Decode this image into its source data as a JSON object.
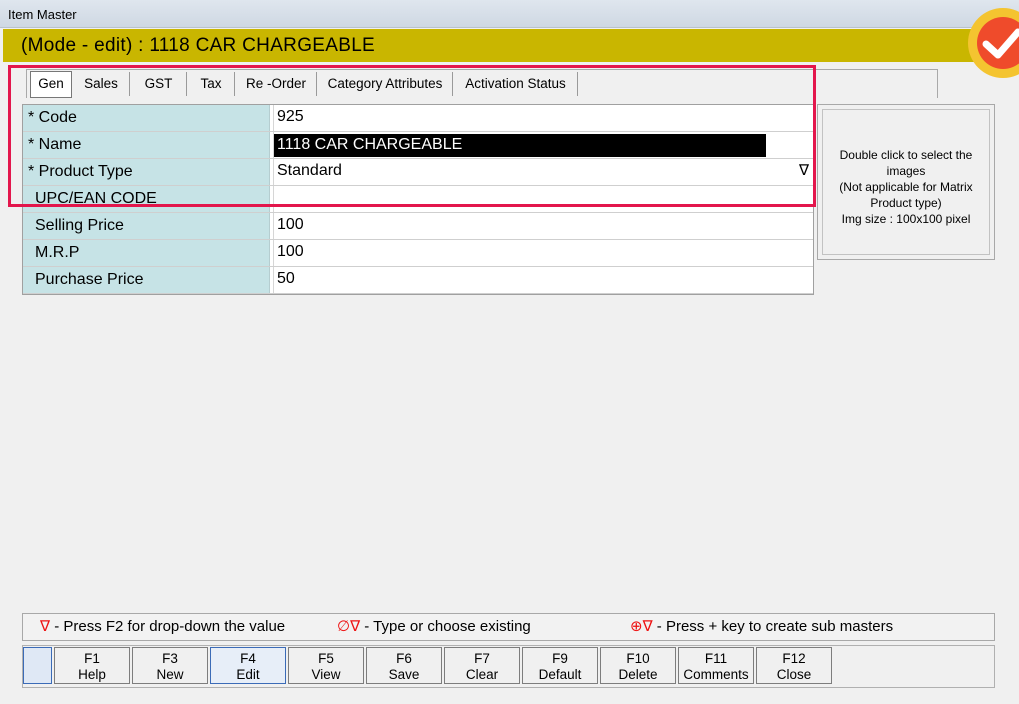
{
  "window": {
    "title": "Item Master"
  },
  "mode_bar": {
    "text": "(Mode - edit)  :  1118 CAR CHARGEABLE"
  },
  "tabs": [
    {
      "label": "Gen"
    },
    {
      "label": "Sales"
    },
    {
      "label": "GST"
    },
    {
      "label": "Tax"
    },
    {
      "label": "Re -Order"
    },
    {
      "label": "Category Attributes"
    },
    {
      "label": "Activation Status"
    }
  ],
  "fields": [
    {
      "label": "* Code",
      "value": "925"
    },
    {
      "label": "* Name",
      "value": "1118 CAR CHARGEABLE"
    },
    {
      "label": "* Product Type",
      "value": "Standard"
    },
    {
      "label": "UPC/EAN CODE",
      "value": ""
    },
    {
      "label": "Selling Price",
      "value": "100"
    },
    {
      "label": "M.R.P",
      "value": "100"
    },
    {
      "label": "Purchase Price",
      "value": "50"
    }
  ],
  "dropdown_glyph": "∇",
  "image_panel": {
    "lines": [
      "Double click to select the",
      "images",
      "(Not applicable for Matrix",
      "Product type)",
      "Img size : 100x100 pixel"
    ]
  },
  "legend": {
    "item1_symbol": "∇",
    "item1_text": " - Press F2 for drop-down the value",
    "item2_symbol": "∅∇",
    "item2_text": " - Type or choose existing",
    "item3_symbol": "⊕∇",
    "item3_text": " - Press + key to create sub masters"
  },
  "function_keys": [
    {
      "key": "",
      "label": ""
    },
    {
      "key": "F1",
      "label": "Help"
    },
    {
      "key": "F3",
      "label": "New"
    },
    {
      "key": "F4",
      "label": "Edit"
    },
    {
      "key": "F5",
      "label": "View"
    },
    {
      "key": "F6",
      "label": "Save"
    },
    {
      "key": "F7",
      "label": "Clear"
    },
    {
      "key": "F9",
      "label": "Default"
    },
    {
      "key": "F10",
      "label": "Delete"
    },
    {
      "key": "F11",
      "label": "Comments"
    },
    {
      "key": "F12",
      "label": "Close"
    }
  ],
  "colors": {
    "mode_bar": "#c9b600",
    "label_cell": "#c6e3e6",
    "highlight_frame": "#e3164c",
    "legend_symbol": "#ee1111",
    "badge_outer": "#f4c430",
    "badge_inner": "#ef4b2b"
  }
}
